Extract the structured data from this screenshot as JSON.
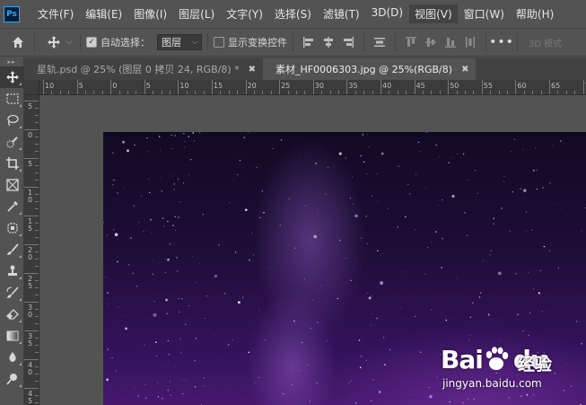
{
  "app": {
    "logo_text": "Ps"
  },
  "menu": {
    "items": [
      {
        "label": "文件(F)"
      },
      {
        "label": "编辑(E)"
      },
      {
        "label": "图像(I)"
      },
      {
        "label": "图层(L)"
      },
      {
        "label": "文字(Y)"
      },
      {
        "label": "选择(S)"
      },
      {
        "label": "滤镜(T)"
      },
      {
        "label": "3D(D)"
      },
      {
        "label": "视图(V)"
      },
      {
        "label": "窗口(W)"
      },
      {
        "label": "帮助(H)"
      }
    ]
  },
  "options": {
    "auto_select_label": "自动选择：",
    "auto_select_checked": true,
    "layer_select_value": "图层",
    "show_transform_label": "显示变换控件",
    "show_transform_checked": false,
    "more_label": "•••",
    "mode_3d_label": "3D 模式"
  },
  "tabs": [
    {
      "label": "星轨.psd @ 25% (图层 0 拷贝 24, RGB/8) *",
      "close": "✖",
      "active": false
    },
    {
      "label": "素材_HF0006303.jpg @ 25%(RGB/8)",
      "close": "✖",
      "active": true
    }
  ],
  "ruler": {
    "h_labels": [
      "10",
      "5",
      "0",
      "5",
      "10",
      "15",
      "20",
      "25",
      "30",
      "35",
      "40",
      "45",
      "50",
      "55",
      "60",
      "65",
      "70"
    ],
    "v_labels": [
      "5",
      "0",
      "5",
      "1\n0",
      "1\n5",
      "2\n0",
      "2\n5",
      "3\n0",
      "3\n5",
      "4\n0",
      "4\n5"
    ]
  },
  "tools": [
    {
      "name": "move-tool",
      "icon": "move-icon",
      "selected": true
    },
    {
      "name": "marquee-tool",
      "icon": "marquee-icon"
    },
    {
      "name": "lasso-tool",
      "icon": "lasso-icon"
    },
    {
      "name": "quick-select-tool",
      "icon": "quick-select-icon"
    },
    {
      "name": "crop-tool",
      "icon": "crop-icon"
    },
    {
      "name": "frame-tool",
      "icon": "frame-icon"
    },
    {
      "name": "eyedropper-tool",
      "icon": "eyedropper-icon"
    },
    {
      "name": "healing-tool",
      "icon": "healing-icon"
    },
    {
      "name": "brush-tool",
      "icon": "brush-icon"
    },
    {
      "name": "stamp-tool",
      "icon": "stamp-icon"
    },
    {
      "name": "history-brush-tool",
      "icon": "history-brush-icon"
    },
    {
      "name": "eraser-tool",
      "icon": "eraser-icon"
    },
    {
      "name": "gradient-tool",
      "icon": "gradient-icon"
    },
    {
      "name": "blur-tool",
      "icon": "blur-icon"
    },
    {
      "name": "dodge-tool",
      "icon": "dodge-icon"
    }
  ],
  "watermark": {
    "brand_bai": "Bai",
    "brand_du": "du",
    "service": "经验",
    "url": "jingyan.baidu.com"
  },
  "colors": {
    "ui_bg": "#535353",
    "panel_dark": "#424242",
    "ps_blue": "#31a8ff",
    "sky_top": "#120a24",
    "sky_bottom": "#4a1a74"
  }
}
